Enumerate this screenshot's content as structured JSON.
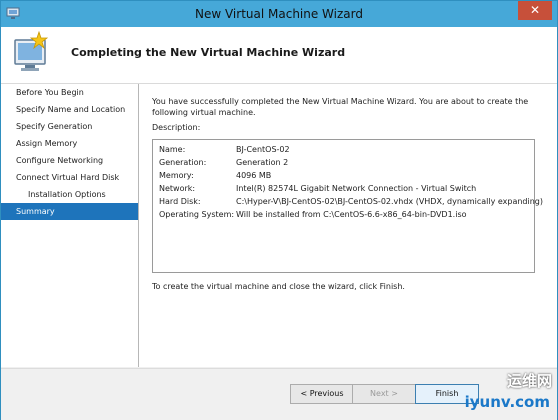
{
  "window": {
    "title": "New Virtual Machine Wizard",
    "close_label": "✕"
  },
  "header": {
    "title": "Completing the New Virtual Machine Wizard"
  },
  "steps": [
    {
      "label": "Before You Begin",
      "sub": false,
      "active": false
    },
    {
      "label": "Specify Name and Location",
      "sub": false,
      "active": false
    },
    {
      "label": "Specify Generation",
      "sub": false,
      "active": false
    },
    {
      "label": "Assign Memory",
      "sub": false,
      "active": false
    },
    {
      "label": "Configure Networking",
      "sub": false,
      "active": false
    },
    {
      "label": "Connect Virtual Hard Disk",
      "sub": false,
      "active": false
    },
    {
      "label": "Installation Options",
      "sub": true,
      "active": false
    },
    {
      "label": "Summary",
      "sub": false,
      "active": true
    }
  ],
  "content": {
    "intro": "You have successfully completed the New Virtual Machine Wizard. You are about to create the following virtual machine.",
    "description_label": "Description:",
    "details": [
      {
        "key": "Name:",
        "value": "BJ-CentOS-02"
      },
      {
        "key": "Generation:",
        "value": "Generation 2"
      },
      {
        "key": "Memory:",
        "value": "4096 MB"
      },
      {
        "key": "Network:",
        "value": "Intel(R) 82574L Gigabit Network Connection - Virtual Switch"
      },
      {
        "key": "Hard Disk:",
        "value": "C:\\Hyper-V\\BJ-CentOS-02\\BJ-CentOS-02.vhdx (VHDX, dynamically expanding)"
      },
      {
        "key": "Operating System:",
        "value": "Will be installed from C:\\CentOS-6.6-x86_64-bin-DVD1.iso"
      }
    ],
    "finish_note": "To create the virtual machine and close the wizard, click Finish."
  },
  "buttons": {
    "previous": "< Previous",
    "next": "Next >",
    "finish": "Finish"
  },
  "watermark": {
    "line1": "运维网",
    "line2": "iyunv.com"
  },
  "colors": {
    "titlebar": "#46a8d8",
    "active_step": "#1e74bb",
    "close": "#c7503a"
  }
}
